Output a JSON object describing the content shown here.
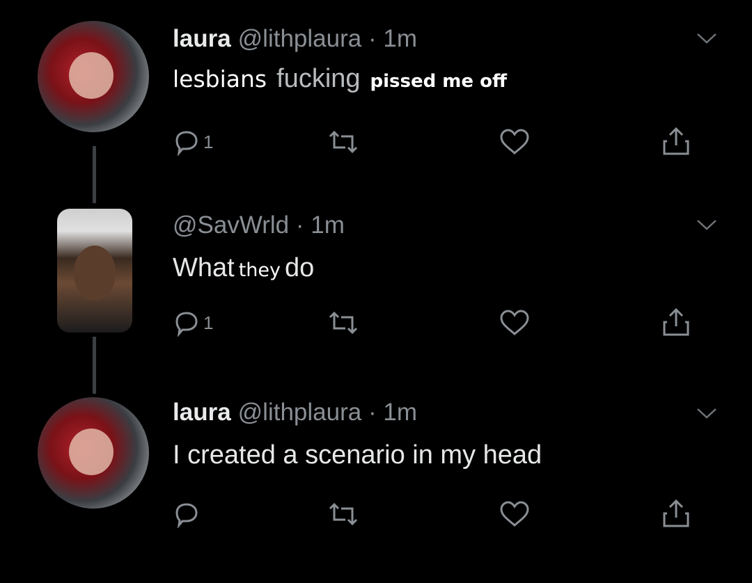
{
  "colors": {
    "background": "#000000",
    "text": "#e6e7e8",
    "muted": "#8a8f95",
    "thread_line": "#3c3f44"
  },
  "tweets": [
    {
      "name": "laura",
      "handle": "@lithplaura",
      "separator": "·",
      "time": "1m",
      "body_words": [
        "lesbians",
        "fucking",
        "pissed me off"
      ],
      "reply_count": "1",
      "avatar": "user-avatar-red-hair"
    },
    {
      "name": "",
      "handle": "@SavWrld",
      "separator": "·",
      "time": "1m",
      "body_parts": [
        "What",
        "they",
        "do"
      ],
      "reply_count": "1",
      "avatar": "user-avatar-cap"
    },
    {
      "name": "laura",
      "handle": "@lithplaura",
      "separator": "·",
      "time": "1m",
      "body": "I created a scenario in my head",
      "reply_count": "",
      "avatar": "user-avatar-red-hair"
    }
  ],
  "icons": [
    "reply-icon",
    "retweet-icon",
    "like-icon",
    "share-icon",
    "chevron-down-icon"
  ]
}
